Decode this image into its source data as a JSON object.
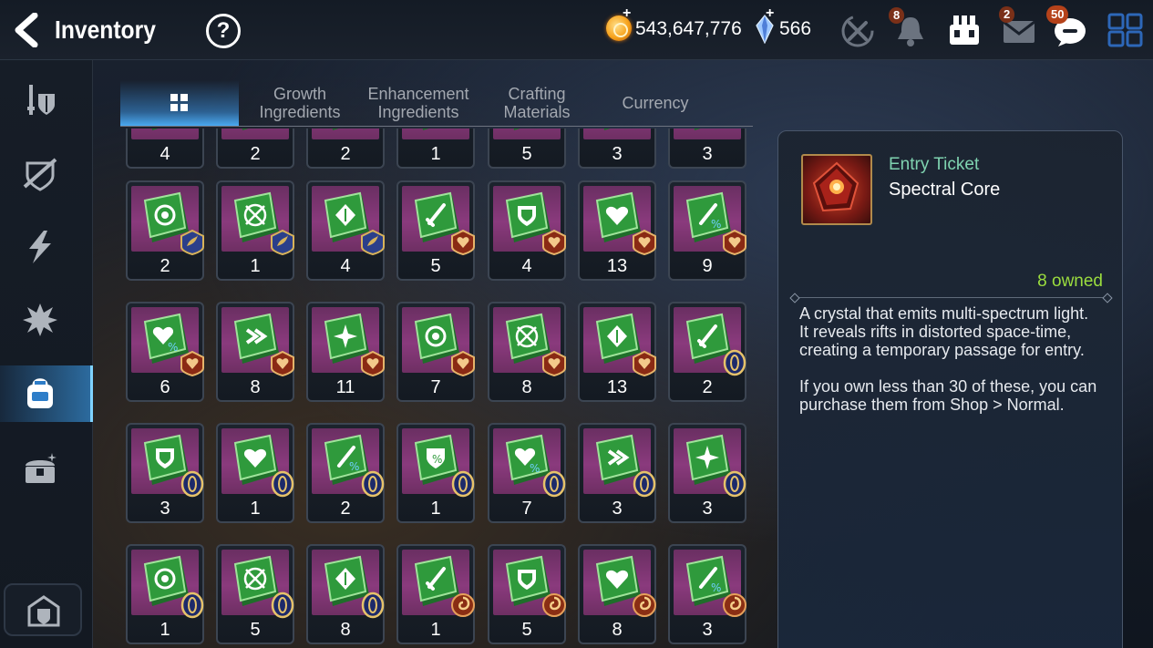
{
  "header": {
    "title": "Inventory",
    "help_symbol": "?",
    "gold_value": "543,647,776",
    "crystal_value": "566",
    "plus_symbol": "+",
    "badges": {
      "bell": "8",
      "mail": "2",
      "chat": "50"
    }
  },
  "tabs": [
    {
      "label": "",
      "icon": "grid-icon",
      "active": true
    },
    {
      "label": "Growth\nIngredients"
    },
    {
      "label": "Enhancement\nIngredients"
    },
    {
      "label": "Crafting\nMaterials"
    },
    {
      "label": "Currency"
    }
  ],
  "sidebar": {
    "items": [
      "equipment-icon",
      "unequip-shield-icon",
      "lightning-icon",
      "artifact-burst-icon",
      "backpack-icon",
      "chest-icon"
    ],
    "active_index": 4,
    "bottom": "storage-house-icon"
  },
  "grid": {
    "rows": [
      {
        "quantities": [
          "4",
          "2",
          "2",
          "1",
          "5",
          "3",
          "3"
        ],
        "emblems": []
      },
      {
        "quantities": [
          "2",
          "1",
          "4",
          "5",
          "4",
          "13",
          "9"
        ],
        "emblems": [
          "wing",
          "wing",
          "wing",
          "heart",
          "heart",
          "heart",
          "heart"
        ],
        "gems": [
          "gear",
          "target",
          "crown",
          "sword",
          "shield",
          "heart",
          "sword-pct"
        ]
      },
      {
        "quantities": [
          "6",
          "8",
          "11",
          "7",
          "8",
          "13",
          "2"
        ],
        "emblems": [
          "heart",
          "heart",
          "heart",
          "heart",
          "heart",
          "heart",
          "oval"
        ],
        "gems": [
          "heart-pct",
          "arrow",
          "burst",
          "gear",
          "target",
          "crown",
          "sword"
        ]
      },
      {
        "quantities": [
          "3",
          "1",
          "2",
          "1",
          "7",
          "3",
          "3"
        ],
        "emblems": [
          "oval",
          "oval",
          "oval",
          "oval",
          "oval",
          "oval",
          "oval"
        ],
        "gems": [
          "shield",
          "heart",
          "sword-pct",
          "shield-pct",
          "heart-pct",
          "arrow",
          "burst"
        ]
      },
      {
        "quantities": [
          "1",
          "5",
          "8",
          "1",
          "5",
          "8",
          "3"
        ],
        "emblems": [
          "oval",
          "oval",
          "oval",
          "swirl",
          "swirl",
          "swirl",
          "swirl"
        ],
        "gems": [
          "gear",
          "target",
          "crown",
          "sword",
          "shield",
          "heart",
          "sword-pct"
        ]
      }
    ]
  },
  "detail": {
    "type": "Entry Ticket",
    "name": "Spectral Core",
    "owned": "8 owned",
    "description": "A crystal that emits multi-spectrum light.\nIt reveals rifts in distorted space-time, creating a temporary passage for entry.\n\nIf you own less than 30 of these, you can purchase them from Shop > Normal."
  },
  "colors": {
    "accent_blue": "#4aa8f0",
    "owned_green": "#9bdd3e",
    "type_teal": "#7fd3b0",
    "badge_red": "#b5421a",
    "slot_purple": "#8a3a7d",
    "gem_green": "#2f9a3c"
  }
}
